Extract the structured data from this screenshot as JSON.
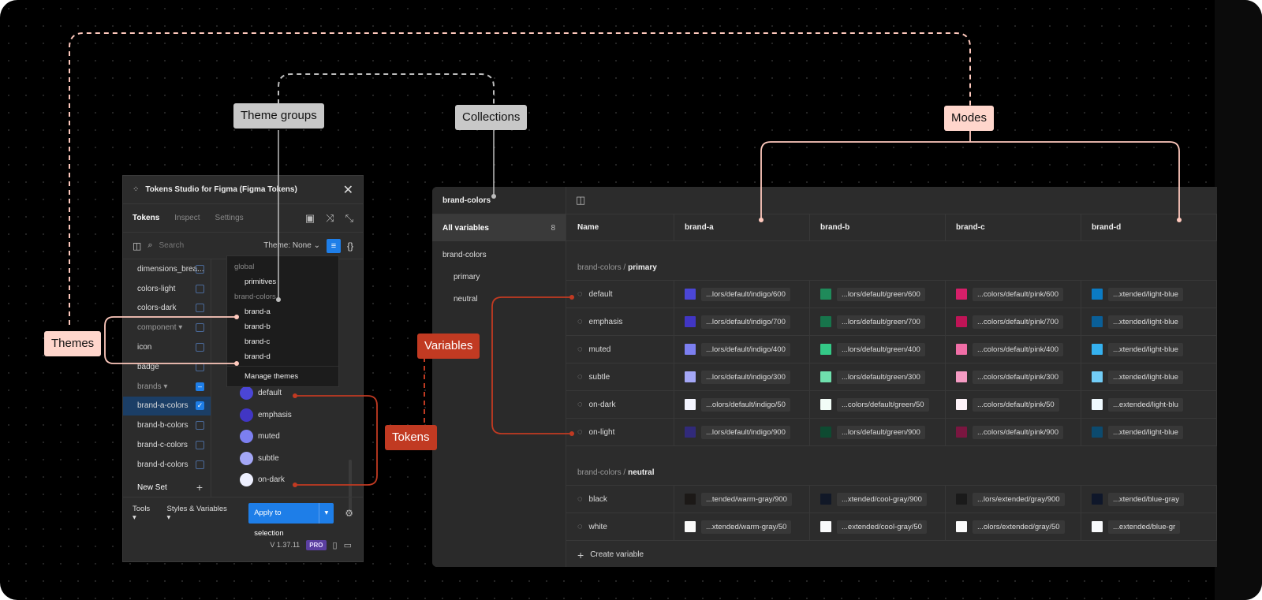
{
  "labels": {
    "theme_groups": "Theme groups",
    "collections": "Collections",
    "modes": "Modes",
    "themes": "Themes",
    "variables": "Variables",
    "tokens": "Tokens"
  },
  "plugin": {
    "title": "Tokens Studio for Figma (Figma Tokens)",
    "tabs": [
      "Tokens",
      "Inspect",
      "Settings"
    ],
    "search_placeholder": "Search",
    "theme_label": "Theme: None",
    "sets": [
      {
        "label": "dimensions_brea...",
        "kind": "set",
        "checked": false
      },
      {
        "label": "colors-light",
        "kind": "set",
        "checked": false
      },
      {
        "label": "colors-dark",
        "kind": "set",
        "checked": false
      },
      {
        "label": "component",
        "kind": "folder",
        "checked": false
      },
      {
        "label": "icon",
        "kind": "set",
        "checked": false
      },
      {
        "label": "badge",
        "kind": "set",
        "checked": false
      },
      {
        "label": "brands",
        "kind": "folder",
        "checked": "partial"
      },
      {
        "label": "brand-a-colors",
        "kind": "set",
        "checked": true,
        "active": true
      },
      {
        "label": "brand-b-colors",
        "kind": "set",
        "checked": false
      },
      {
        "label": "brand-c-colors",
        "kind": "set",
        "checked": false
      },
      {
        "label": "brand-d-colors",
        "kind": "set",
        "checked": false
      }
    ],
    "new_set": "New Set",
    "tokens": [
      {
        "label": "default",
        "color": "#4b46d6"
      },
      {
        "label": "emphasis",
        "color": "#4136c4"
      },
      {
        "label": "muted",
        "color": "#7c7ff0"
      },
      {
        "label": "subtle",
        "color": "#a4a7f6"
      },
      {
        "label": "on-dark",
        "color": "#eef0ff"
      }
    ],
    "footer": {
      "tools": "Tools",
      "styles_variables": "Styles & Variables",
      "apply": "Apply to selection"
    },
    "version": "V 1.37.11",
    "pro_badge": "PRO"
  },
  "theme_dropdown": {
    "groups": [
      {
        "name": "global",
        "options": [
          "primitives"
        ]
      },
      {
        "name": "brand-colors",
        "options": [
          "brand-a",
          "brand-b",
          "brand-c",
          "brand-d"
        ]
      }
    ],
    "manage": "Manage themes"
  },
  "variables_panel": {
    "collection_title": "brand-colors",
    "all_variables": "All variables",
    "count": "8",
    "collection": "brand-colors",
    "groups_nav": [
      "primary",
      "neutral"
    ],
    "columns": [
      "Name",
      "brand-a",
      "brand-b",
      "brand-c",
      "brand-d"
    ],
    "sections": [
      {
        "prefix": "brand-colors /",
        "name": "primary",
        "rows": [
          {
            "name": "default",
            "cells": [
              {
                "v": "...lors/default/indigo/600",
                "c": "#4b46d6"
              },
              {
                "v": "...lors/default/green/600",
                "c": "#1f8a5a"
              },
              {
                "v": "...colors/default/pink/600",
                "c": "#d61f69"
              },
              {
                "v": "...xtended/light-blue",
                "c": "#0b7bc4"
              }
            ]
          },
          {
            "name": "emphasis",
            "cells": [
              {
                "v": "...lors/default/indigo/700",
                "c": "#4136c4"
              },
              {
                "v": "...lors/default/green/700",
                "c": "#17744b"
              },
              {
                "v": "...colors/default/pink/700",
                "c": "#bf1456"
              },
              {
                "v": "...xtended/light-blue",
                "c": "#0a5f98"
              }
            ]
          },
          {
            "name": "muted",
            "cells": [
              {
                "v": "...lors/default/indigo/400",
                "c": "#7c7ff0"
              },
              {
                "v": "...lors/default/green/400",
                "c": "#34c987"
              },
              {
                "v": "...colors/default/pink/400",
                "c": "#f06ea6"
              },
              {
                "v": "...xtended/light-blue",
                "c": "#35b1ef"
              }
            ]
          },
          {
            "name": "subtle",
            "cells": [
              {
                "v": "...lors/default/indigo/300",
                "c": "#a4a7f6"
              },
              {
                "v": "...lors/default/green/300",
                "c": "#6fe0ad"
              },
              {
                "v": "...colors/default/pink/300",
                "c": "#f59bc3"
              },
              {
                "v": "...xtended/light-blue",
                "c": "#72cdf7"
              }
            ]
          },
          {
            "name": "on-dark",
            "cells": [
              {
                "v": "...olors/default/indigo/50",
                "c": "#f4f5ff"
              },
              {
                "v": "...colors/default/green/50",
                "c": "#f2fdf7"
              },
              {
                "v": "...colors/default/pink/50",
                "c": "#fdf2f8"
              },
              {
                "v": "...extended/light-blu",
                "c": "#f0faff"
              }
            ]
          },
          {
            "name": "on-light",
            "cells": [
              {
                "v": "...lors/default/indigo/900",
                "c": "#312a7a"
              },
              {
                "v": "...lors/default/green/900",
                "c": "#0e4a31"
              },
              {
                "v": "...colors/default/pink/900",
                "c": "#7a1640"
              },
              {
                "v": "...xtended/light-blue",
                "c": "#0c4a6e"
              }
            ]
          }
        ]
      },
      {
        "prefix": "brand-colors /",
        "name": "neutral",
        "rows": [
          {
            "name": "black",
            "cells": [
              {
                "v": "...tended/warm-gray/900",
                "c": "#1c1917"
              },
              {
                "v": "...xtended/cool-gray/900",
                "c": "#111827"
              },
              {
                "v": "...lors/extended/gray/900",
                "c": "#1a1a1a"
              },
              {
                "v": "...xtended/blue-gray",
                "c": "#0f172a"
              }
            ]
          },
          {
            "name": "white",
            "cells": [
              {
                "v": "...xtended/warm-gray/50",
                "c": "#fafaf9"
              },
              {
                "v": "...extended/cool-gray/50",
                "c": "#f9fafb"
              },
              {
                "v": "...olors/extended/gray/50",
                "c": "#fafafa"
              },
              {
                "v": "...extended/blue-gr",
                "c": "#f8fafc"
              }
            ]
          }
        ]
      }
    ],
    "create_variable": "Create variable"
  },
  "colors": {
    "pink_line": "#ffc9bd",
    "grey_line": "#bdbdbd",
    "red_line": "#c13a22",
    "accent_blue": "#1e7ee8"
  }
}
